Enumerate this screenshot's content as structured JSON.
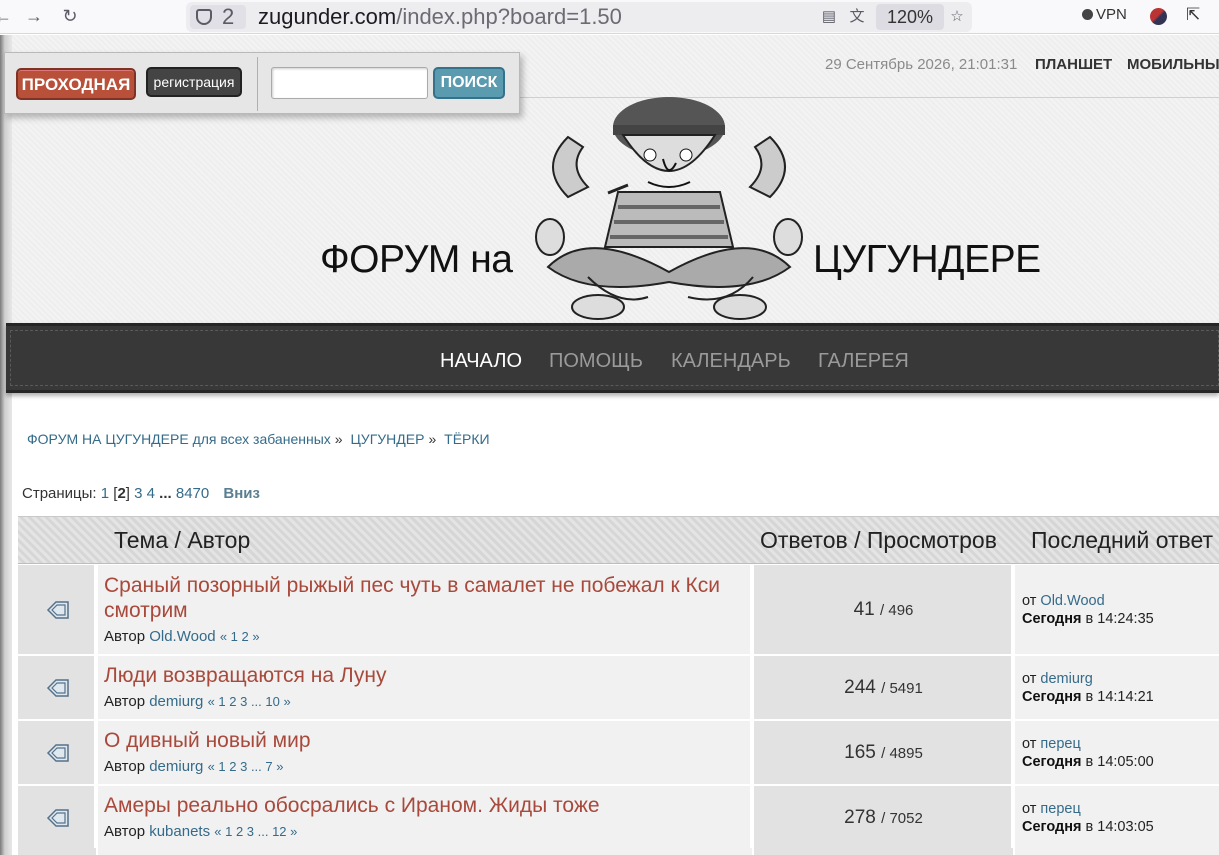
{
  "browser": {
    "tab_count": "2",
    "url_host": "zugunder.com",
    "url_path": "/index.php?board=1.50",
    "zoom": "120%",
    "vpn_label": "VPN",
    "icons": [
      "back-icon",
      "forward-icon",
      "reload-icon",
      "shield-icon",
      "reader-icon",
      "translate-icon",
      "star-icon",
      "extensions-icon"
    ]
  },
  "login": {
    "enter_label": "ПРОХОДНАЯ",
    "register_label": "регистрация",
    "search_label": "ПОИСК",
    "search_value": ""
  },
  "header": {
    "datetime": "29 Сентябрь 2026, 21:01:31",
    "tablet_label": "ПЛАНШЕТ",
    "mobile_label": "МОБИЛЬНЫ",
    "logo_left": "ФОРУМ на",
    "logo_right": "ЦУГУНДЕРЕ"
  },
  "nav": {
    "items": [
      {
        "label": "НАЧАЛО",
        "active": true
      },
      {
        "label": "ПОМОЩЬ",
        "active": false
      },
      {
        "label": "КАЛЕНДАРЬ",
        "active": false
      },
      {
        "label": "ГАЛЕРЕЯ",
        "active": false
      }
    ]
  },
  "breadcrumb": {
    "items": [
      "ФОРУМ НА ЦУГУНДЕРЕ для всех забаненных",
      "ЦУГУНДЕР",
      "ТЁРКИ"
    ],
    "separator": "»"
  },
  "pagination": {
    "label": "Страницы:",
    "p1": "1",
    "current": "2",
    "p3": "3",
    "p4": "4",
    "ellipsis": "...",
    "last": "8470",
    "down_label": "Вниз"
  },
  "table": {
    "headers": {
      "topic": "Тема / Автор",
      "stats": "Ответов / Просмотров",
      "last": "Последний ответ"
    },
    "author_prefix": "Автор",
    "from_prefix": "от",
    "today_label": "Сегодня",
    "at_label": "в",
    "rows": [
      {
        "title": "Сраный позорный рыжый пес чуть в самалет не побежал к Кси смотрим",
        "author": "Old.Wood",
        "pages": "« 1 2 »",
        "replies": "41",
        "views": "/ 496",
        "last_by": "Old.Wood",
        "last_time": "14:24:35"
      },
      {
        "title": "Люди возвращаются на Луну",
        "author": "demiurg",
        "pages": "« 1 2 3 ... 10 »",
        "replies": "244",
        "views": "/ 5491",
        "last_by": "demiurg",
        "last_time": "14:14:21"
      },
      {
        "title": "О дивный новый мир",
        "author": "demiurg",
        "pages": "« 1 2 3 ... 7 »",
        "replies": "165",
        "views": "/ 4895",
        "last_by": "перец",
        "last_time": "14:05:00"
      },
      {
        "title": "Амеры реально обосрались с Ираном. Жиды тоже",
        "author": "kubanets",
        "pages": "« 1 2 3 ... 12 »",
        "replies": "278",
        "views": "/ 7052",
        "last_by": "перец",
        "last_time": "14:03:05"
      }
    ]
  }
}
